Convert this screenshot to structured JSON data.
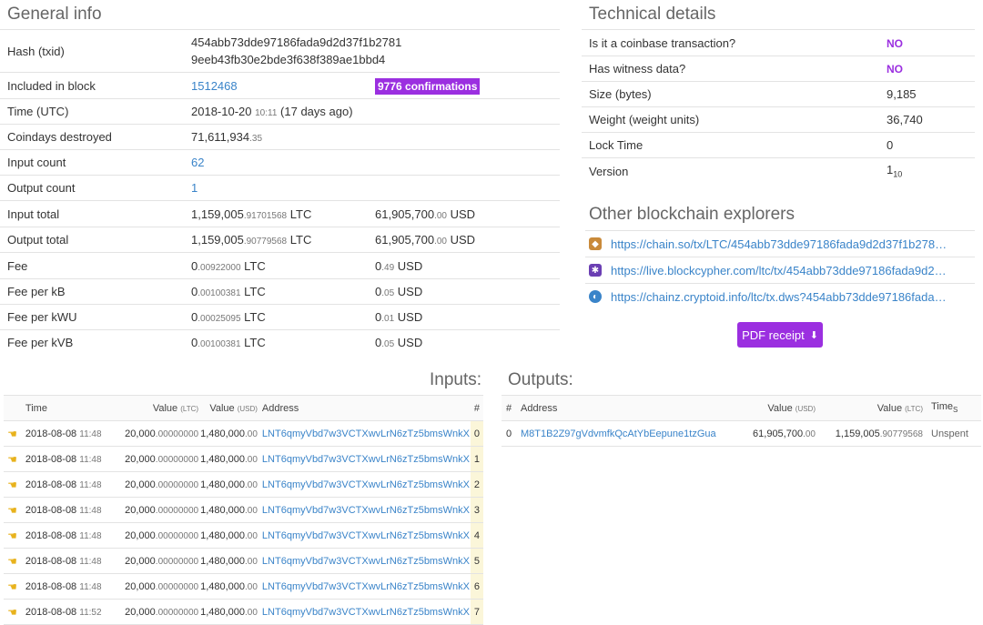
{
  "general": {
    "title": "General info",
    "hash_label": "Hash (txid)",
    "hash_line1": "454abb73dde97186fada9d2d37f1b2781",
    "hash_line2": "9eeb43fb30e2bde3f638f389ae1bbd4",
    "block_label": "Included in block",
    "block_value": "1512468",
    "confirmations": "9776 confirmations",
    "time_label": "Time (UTC)",
    "time_date": "2018-10-20",
    "time_clock": "10:11",
    "time_ago": "(17 days ago)",
    "coindays_label": "Coindays destroyed",
    "coindays_main": "71,611,934",
    "coindays_frac": ".35",
    "input_count_label": "Input count",
    "input_count": "62",
    "output_count_label": "Output count",
    "output_count": "1",
    "input_total_label": "Input total",
    "input_total_main": "1,159,005",
    "input_total_frac": ".91701568",
    "input_total_unit": "LTC",
    "input_total_usd_main": "61,905,700",
    "input_total_usd_frac": ".00",
    "output_total_label": "Output total",
    "output_total_main": "1,159,005",
    "output_total_frac": ".90779568",
    "output_total_unit": "LTC",
    "output_total_usd_main": "61,905,700",
    "output_total_usd_frac": ".00",
    "fee_label": "Fee",
    "fee_main": "0",
    "fee_frac": ".00922000",
    "fee_unit": "LTC",
    "fee_usd_main": "0",
    "fee_usd_frac": ".49",
    "fee_kb_label": "Fee per kB",
    "fee_kb_main": "0",
    "fee_kb_frac": ".00100381",
    "fee_kb_usd_frac": ".05",
    "fee_kwu_label": "Fee per kWU",
    "fee_kwu_main": "0",
    "fee_kwu_frac": ".00025095",
    "fee_kwu_usd_frac": ".01",
    "fee_kvb_label": "Fee per kVB",
    "fee_kvb_main": "0",
    "fee_kvb_frac": ".00100381",
    "fee_kvb_usd_frac": ".05",
    "usd_unit": "USD"
  },
  "technical": {
    "title": "Technical details",
    "coinbase_label": "Is it a coinbase transaction?",
    "coinbase_value": "NO",
    "witness_label": "Has witness data?",
    "witness_value": "NO",
    "size_label": "Size (bytes)",
    "size_value": "9,185",
    "weight_label": "Weight (weight units)",
    "weight_value": "36,740",
    "locktime_label": "Lock Time",
    "locktime_value": "0",
    "version_label": "Version",
    "version_value": "1",
    "version_base": "10"
  },
  "explorers": {
    "title": "Other blockchain explorers",
    "items": [
      {
        "url": "https://chain.so/tx/LTC/454abb73dde97186fada9d2d37f1b2781...",
        "icon": "chainso-icon",
        "color": "#c98a3a"
      },
      {
        "url": "https://live.blockcypher.com/ltc/tx/454abb73dde97186fada9d2d3...",
        "icon": "blockcypher-icon",
        "color": "#6b3fb3"
      },
      {
        "url": "https://chainz.cryptoid.info/ltc/tx.dws?454abb73dde97186fada9d...",
        "icon": "cryptoid-icon",
        "color": "#3a84c9"
      }
    ],
    "pdf_label": "PDF receipt"
  },
  "inputs": {
    "title": "Inputs:",
    "headers": {
      "time": "Time",
      "value_ltc": "Value",
      "ltc_unit": "(LTC)",
      "value_usd": "Value",
      "usd_unit": "(USD)",
      "address": "Address",
      "index": "#"
    },
    "rows": [
      {
        "date": "2018-08-08",
        "clock": "11:48",
        "ltc_main": "20,000",
        "ltc_frac": ".00000000",
        "usd_main": "1,480,000",
        "usd_frac": ".00",
        "address": "LNT6qmyVbd7w3VCTXwvLrN6zTz5bmsWnkX",
        "index": "0"
      },
      {
        "date": "2018-08-08",
        "clock": "11:48",
        "ltc_main": "20,000",
        "ltc_frac": ".00000000",
        "usd_main": "1,480,000",
        "usd_frac": ".00",
        "address": "LNT6qmyVbd7w3VCTXwvLrN6zTz5bmsWnkX",
        "index": "1"
      },
      {
        "date": "2018-08-08",
        "clock": "11:48",
        "ltc_main": "20,000",
        "ltc_frac": ".00000000",
        "usd_main": "1,480,000",
        "usd_frac": ".00",
        "address": "LNT6qmyVbd7w3VCTXwvLrN6zTz5bmsWnkX",
        "index": "2"
      },
      {
        "date": "2018-08-08",
        "clock": "11:48",
        "ltc_main": "20,000",
        "ltc_frac": ".00000000",
        "usd_main": "1,480,000",
        "usd_frac": ".00",
        "address": "LNT6qmyVbd7w3VCTXwvLrN6zTz5bmsWnkX",
        "index": "3"
      },
      {
        "date": "2018-08-08",
        "clock": "11:48",
        "ltc_main": "20,000",
        "ltc_frac": ".00000000",
        "usd_main": "1,480,000",
        "usd_frac": ".00",
        "address": "LNT6qmyVbd7w3VCTXwvLrN6zTz5bmsWnkX",
        "index": "4"
      },
      {
        "date": "2018-08-08",
        "clock": "11:48",
        "ltc_main": "20,000",
        "ltc_frac": ".00000000",
        "usd_main": "1,480,000",
        "usd_frac": ".00",
        "address": "LNT6qmyVbd7w3VCTXwvLrN6zTz5bmsWnkX",
        "index": "5"
      },
      {
        "date": "2018-08-08",
        "clock": "11:48",
        "ltc_main": "20,000",
        "ltc_frac": ".00000000",
        "usd_main": "1,480,000",
        "usd_frac": ".00",
        "address": "LNT6qmyVbd7w3VCTXwvLrN6zTz5bmsWnkX",
        "index": "6"
      },
      {
        "date": "2018-08-08",
        "clock": "11:52",
        "ltc_main": "20,000",
        "ltc_frac": ".00000000",
        "usd_main": "1,480,000",
        "usd_frac": ".00",
        "address": "LNT6qmyVbd7w3VCTXwvLrN6zTz5bmsWnkX",
        "index": "7"
      }
    ]
  },
  "outputs": {
    "title": "Outputs:",
    "headers": {
      "index": "#",
      "address": "Address",
      "value_usd": "Value",
      "usd_unit": "(USD)",
      "value_ltc": "Value",
      "ltc_unit": "(LTC)",
      "time": "Time",
      "time_sub": "S"
    },
    "rows": [
      {
        "index": "0",
        "address": "M8T1B2Z97gVdvmfkQcAtYbEepune1tzGua",
        "usd_main": "61,905,700",
        "usd_frac": ".00",
        "ltc_main": "1,159,005",
        "ltc_frac": ".90779568",
        "status": "Unspent"
      }
    ]
  }
}
